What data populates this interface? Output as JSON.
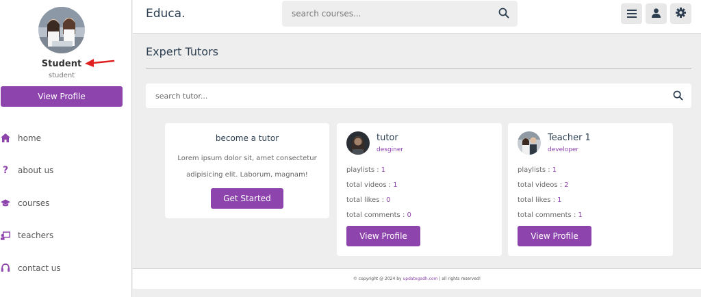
{
  "sidebar": {
    "user_name": "Student",
    "user_role": "student",
    "profile_button": "View Profile",
    "nav": [
      {
        "label": "home",
        "icon": "home-icon"
      },
      {
        "label": "about us",
        "icon": "question-icon"
      },
      {
        "label": "courses",
        "icon": "graduation-cap-icon"
      },
      {
        "label": "teachers",
        "icon": "chalkboard-teacher-icon"
      },
      {
        "label": "contact us",
        "icon": "headset-icon"
      }
    ]
  },
  "header": {
    "logo": "Educa.",
    "search_placeholder": "search courses...",
    "buttons": [
      "menu-icon",
      "user-icon",
      "gear-icon"
    ]
  },
  "main": {
    "title": "Expert Tutors",
    "tutor_search_placeholder": "search tutor...",
    "become_tutor": {
      "title": "become a tutor",
      "description": "Lorem ipsum dolor sit, amet consectetur adipisicing elit. Laborum, magnam!",
      "button": "Get Started"
    },
    "tutors": [
      {
        "name": "tutor",
        "role": "desginer",
        "stats": [
          {
            "label": "playlists : ",
            "value": "1"
          },
          {
            "label": "total videos : ",
            "value": "1"
          },
          {
            "label": "total likes : ",
            "value": "0"
          },
          {
            "label": "total comments : ",
            "value": "0"
          }
        ],
        "button": "View Profile"
      },
      {
        "name": "Teacher 1",
        "role": "developer",
        "stats": [
          {
            "label": "playlists : ",
            "value": "1"
          },
          {
            "label": "total videos : ",
            "value": "2"
          },
          {
            "label": "total likes : ",
            "value": "1"
          },
          {
            "label": "total comments : ",
            "value": "1"
          }
        ],
        "button": "View Profile"
      }
    ]
  },
  "footer": {
    "prefix": "© copyright @ 2024 by ",
    "link": "updategadh.com",
    "suffix": " | all rights reserved!"
  },
  "colors": {
    "accent": "#8e44ad",
    "background": "#eeeeee",
    "annotation_arrow": "#e02020"
  }
}
